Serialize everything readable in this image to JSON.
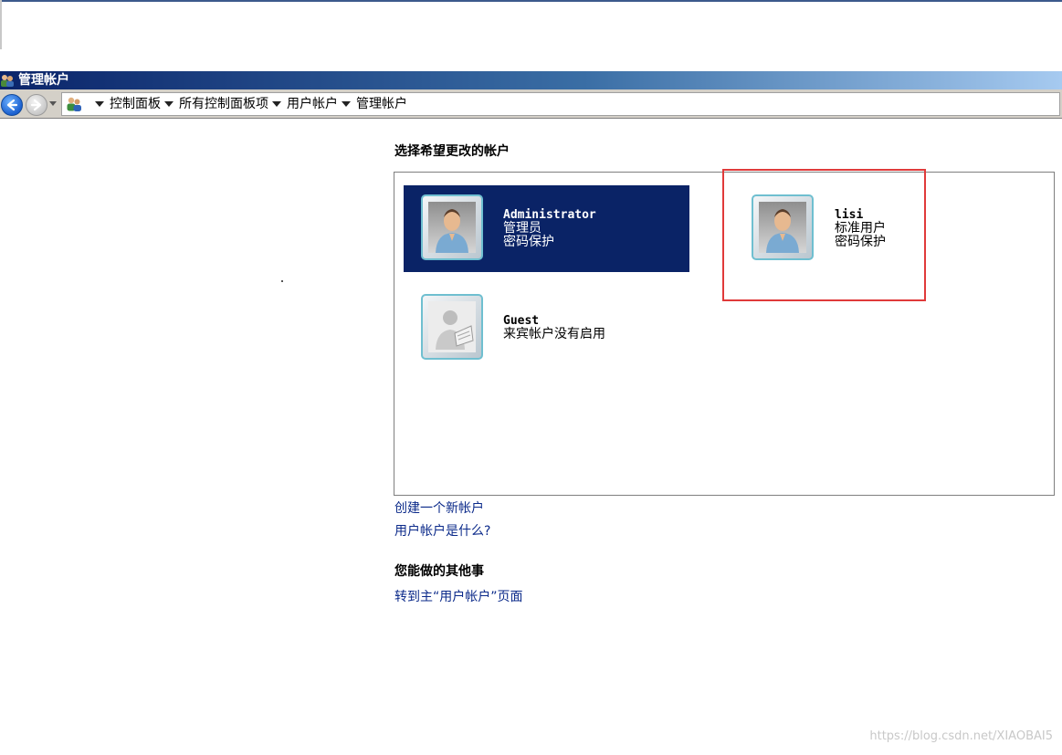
{
  "window": {
    "title": "管理帐户"
  },
  "breadcrumb": {
    "items": [
      "控制面板",
      "所有控制面板项",
      "用户帐户",
      "管理帐户"
    ]
  },
  "main": {
    "choose_title": "选择希望更改的帐户",
    "accounts": [
      {
        "name": "Administrator",
        "line1": "管理员",
        "line2": "密码保护",
        "selected": true
      },
      {
        "name": "lisi",
        "line1": "标准用户",
        "line2": "密码保护",
        "selected": false
      },
      {
        "name": "Guest",
        "line1": "来宾帐户没有启用",
        "selected": false
      }
    ],
    "links": {
      "create": "创建一个新帐户",
      "what": "用户帐户是什么?"
    },
    "other_title": "您能做的其他事",
    "other_links": {
      "go_main": "转到主“用户帐户”页面"
    }
  },
  "watermark": "https://blog.csdn.net/XIAOBAI5"
}
